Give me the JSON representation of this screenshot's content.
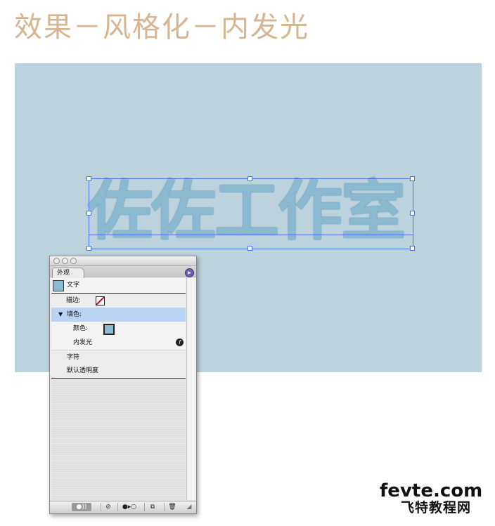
{
  "page": {
    "title": "效果－风格化－内发光"
  },
  "artboard": {
    "text": "佐佐工作室",
    "fill_color": "#8ab9d0",
    "background": "#bcd3de",
    "selection_color": "#4a6fe0"
  },
  "panel": {
    "tab_label": "外观",
    "rows": [
      {
        "label": "文字"
      },
      {
        "label": "描边:"
      },
      {
        "label": "填色:"
      },
      {
        "label": "颜色:"
      },
      {
        "label": "内发光"
      },
      {
        "label": "字符"
      },
      {
        "label": "默认透明度"
      }
    ],
    "toolbar_icons": [
      "new-effect-icon",
      "clear-icon",
      "reduce-icon",
      "duplicate-icon",
      "delete-icon"
    ]
  },
  "watermark": {
    "top": "fevte.com",
    "bottom": "飞特教程网"
  }
}
